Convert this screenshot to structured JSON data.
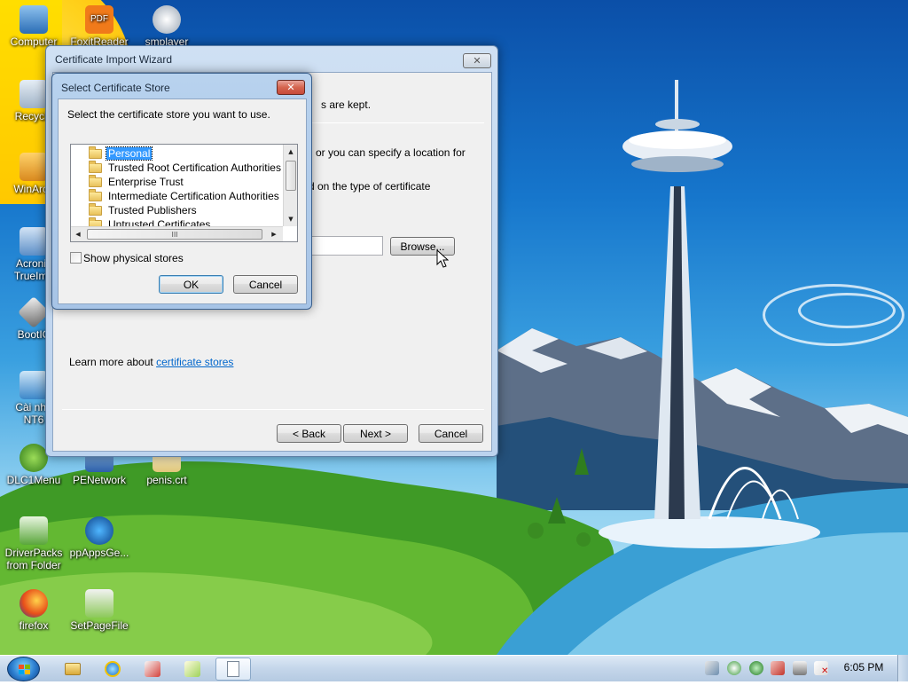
{
  "desktop": {
    "icons": [
      {
        "label": "Computer"
      },
      {
        "label": "Recycle"
      },
      {
        "label": "WinArch"
      },
      {
        "label": "Acronis"
      },
      {
        "label": "TrueIma"
      },
      {
        "label": "BootIC"
      },
      {
        "label": "Cài nha"
      },
      {
        "label": "NT6"
      },
      {
        "label": "DLC1Menu"
      },
      {
        "label": "PENetwork"
      },
      {
        "label": "penis.crt"
      },
      {
        "label": "DriverPacks"
      },
      {
        "label": "from Folder"
      },
      {
        "label": "ppAppsGe..."
      },
      {
        "label": "firefox"
      },
      {
        "label": "SetPageFile"
      },
      {
        "label": "FoxitReader"
      },
      {
        "label": "smplayer"
      }
    ]
  },
  "wizard": {
    "title": "Certificate Import Wizard",
    "partial_line_1": "s are kept.",
    "partial_line_2": "or you can specify a location for",
    "partial_line_3": "d on the type of certificate",
    "browse_label": "Browse...",
    "learn_more_prefix": "Learn more about ",
    "learn_more_link": "certificate stores",
    "back_label": "< Back",
    "next_label": "Next >",
    "cancel_label": "Cancel"
  },
  "store_dialog": {
    "title": "Select Certificate Store",
    "prompt": "Select the certificate store you want to use.",
    "stores": [
      "Personal",
      "Trusted Root Certification Authorities",
      "Enterprise Trust",
      "Intermediate Certification Authorities",
      "Trusted Publishers",
      "Untrusted Certificates"
    ],
    "selected_store": "Personal",
    "h_scroll_grip": "III",
    "show_physical_label": "Show physical stores",
    "show_physical_checked": false,
    "ok_label": "OK",
    "cancel_label": "Cancel",
    "close_glyph": "✕"
  },
  "taskbar": {
    "clock": "6:05 PM",
    "pinned": [
      "explorer-icon",
      "internet-explorer-icon",
      "network-tool-icon",
      "certificate-tool-icon",
      "document-icon"
    ]
  },
  "colors": {
    "selection": "#3399ff",
    "link": "#0066cc",
    "close_button": "#c74a3a"
  }
}
